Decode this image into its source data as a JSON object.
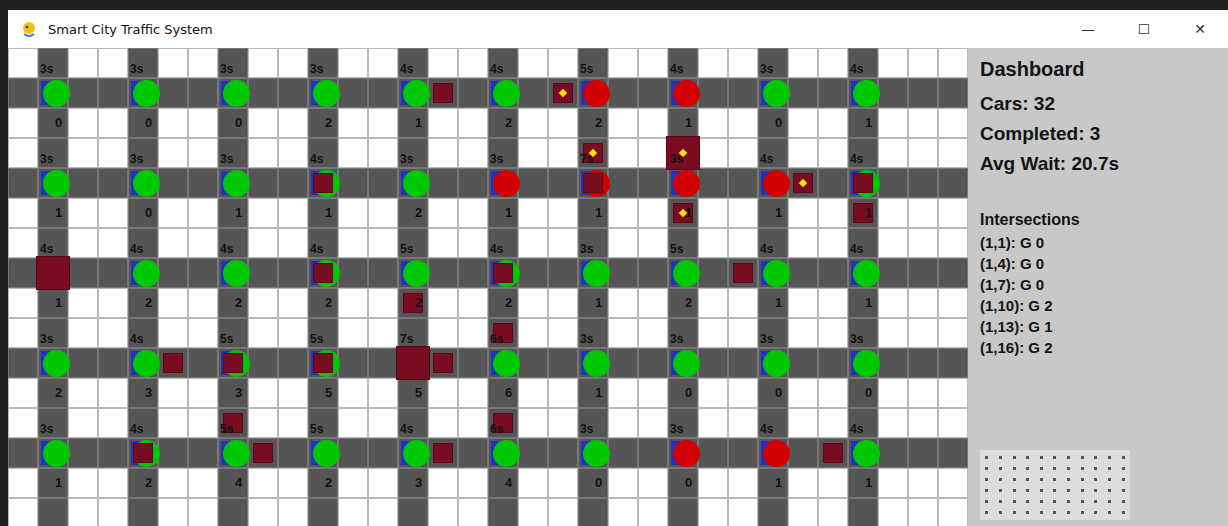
{
  "window": {
    "title": "Smart City Traffic System",
    "controls": [
      "—",
      "☐",
      "✕"
    ]
  },
  "dashboard": {
    "title": "Dashboard",
    "stats": [
      "Cars: 32",
      "Completed: 3",
      "Avg Wait: 20.7s"
    ],
    "intersections_title": "Intersections",
    "intersections": [
      "(1,1): G 0",
      "(1,4): G 0",
      "(1,7): G 0",
      "(1,10): G 2",
      "(1,13): G 1",
      "(1,16): G 2"
    ]
  },
  "grid": {
    "intersection_rows": [
      [
        {
          "timer": "3s",
          "color": "#00c800",
          "queue": "0"
        },
        {
          "timer": "3s",
          "color": "#00c800",
          "queue": "0"
        },
        {
          "timer": "3s",
          "color": "#00c800",
          "queue": "0"
        },
        {
          "timer": "3s",
          "color": "#00c800",
          "queue": "2"
        },
        {
          "timer": "4s",
          "color": "#00c800",
          "queue": "1"
        },
        {
          "timer": "4s",
          "color": "#00c800",
          "queue": "2"
        },
        {
          "timer": "5s",
          "color": "#d20000",
          "queue": "2"
        },
        {
          "timer": "4s",
          "color": "#d20000",
          "queue": "1"
        },
        {
          "timer": "3s",
          "color": "#00c800",
          "queue": "0"
        },
        {
          "timer": "4s",
          "color": "#00c800",
          "queue": "1"
        }
      ],
      [
        {
          "timer": "3s",
          "color": "#00c800",
          "queue": "1"
        },
        {
          "timer": "3s",
          "color": "#00c800",
          "queue": "0"
        },
        {
          "timer": "3s",
          "color": "#00c800",
          "queue": "1"
        },
        {
          "timer": "4s",
          "color": "#00c800",
          "queue": "1"
        },
        {
          "timer": "3s",
          "color": "#00c800",
          "queue": "2"
        },
        {
          "timer": "3s",
          "color": "#d20000",
          "queue": "1"
        },
        {
          "timer": "7s",
          "color": "#d20000",
          "queue": "1"
        },
        {
          "timer": "3s",
          "color": "#d20000",
          "queue": "1"
        },
        {
          "timer": "4s",
          "color": "#d20000",
          "queue": "1"
        },
        {
          "timer": "4s",
          "color": "#00c800",
          "queue": "1"
        }
      ],
      [
        {
          "timer": "4s",
          "color": "#00c800",
          "queue": "1"
        },
        {
          "timer": "4s",
          "color": "#00c800",
          "queue": "2"
        },
        {
          "timer": "4s",
          "color": "#00c800",
          "queue": "2"
        },
        {
          "timer": "4s",
          "color": "#00c800",
          "queue": "2"
        },
        {
          "timer": "5s",
          "color": "#00c800",
          "queue": "2"
        },
        {
          "timer": "4s",
          "color": "#00c800",
          "queue": "2"
        },
        {
          "timer": "3s",
          "color": "#00c800",
          "queue": "1"
        },
        {
          "timer": "5s",
          "color": "#00c800",
          "queue": "2"
        },
        {
          "timer": "4s",
          "color": "#00c800",
          "queue": "1"
        },
        {
          "timer": "4s",
          "color": "#00c800",
          "queue": "1"
        }
      ],
      [
        {
          "timer": "3s",
          "color": "#00c800",
          "queue": "2"
        },
        {
          "timer": "4s",
          "color": "#00c800",
          "queue": "3"
        },
        {
          "timer": "5s",
          "color": "#00c800",
          "queue": "3"
        },
        {
          "timer": "5s",
          "color": "#00c800",
          "queue": "5"
        },
        {
          "timer": "7s",
          "color": "#00c800",
          "queue": "5"
        },
        {
          "timer": "6s",
          "color": "#00c800",
          "queue": "6"
        },
        {
          "timer": "3s",
          "color": "#00c800",
          "queue": "1"
        },
        {
          "timer": "3s",
          "color": "#00c800",
          "queue": "0"
        },
        {
          "timer": "3s",
          "color": "#00c800",
          "queue": "0"
        },
        {
          "timer": "3s",
          "color": "#00c800",
          "queue": "0"
        }
      ],
      [
        {
          "timer": "3s",
          "color": "#00c800",
          "queue": "1"
        },
        {
          "timer": "4s",
          "color": "#00c800",
          "queue": "2"
        },
        {
          "timer": "5s",
          "color": "#00c800",
          "queue": "4"
        },
        {
          "timer": "5s",
          "color": "#00c800",
          "queue": "2"
        },
        {
          "timer": "4s",
          "color": "#00c800",
          "queue": "3"
        },
        {
          "timer": "6s",
          "color": "#00c800",
          "queue": "4"
        },
        {
          "timer": "3s",
          "color": "#00c800",
          "queue": "0"
        },
        {
          "timer": "3s",
          "color": "#d20000",
          "queue": "0"
        },
        {
          "timer": "4s",
          "color": "#d20000",
          "queue": "1"
        },
        {
          "timer": "4s",
          "color": "#00c800",
          "queue": "1"
        }
      ]
    ],
    "cars": [
      {
        "col": 14,
        "row": 1,
        "emergency": false,
        "large": false
      },
      {
        "col": 18,
        "row": 1,
        "emergency": true,
        "large": false
      },
      {
        "col": 19,
        "row": 3,
        "emergency": true,
        "large": false
      },
      {
        "col": 22,
        "row": 3,
        "emergency": true,
        "large": true
      },
      {
        "col": 19,
        "row": 4,
        "emergency": false,
        "large": false
      },
      {
        "col": 22,
        "row": 5,
        "emergency": true,
        "large": false
      },
      {
        "col": 26,
        "row": 4,
        "emergency": true,
        "large": false
      },
      {
        "col": 28,
        "row": 4,
        "emergency": false,
        "large": false
      },
      {
        "col": 28,
        "row": 5,
        "emergency": false,
        "large": false
      },
      {
        "col": 10,
        "row": 4,
        "emergency": false,
        "large": false
      },
      {
        "col": 1,
        "row": 7,
        "emergency": false,
        "large": true
      },
      {
        "col": 10,
        "row": 7,
        "emergency": false,
        "large": false
      },
      {
        "col": 16,
        "row": 7,
        "emergency": false,
        "large": false
      },
      {
        "col": 13,
        "row": 8,
        "emergency": false,
        "large": false
      },
      {
        "col": 24,
        "row": 7,
        "emergency": false,
        "large": false
      },
      {
        "col": 16,
        "row": 9,
        "emergency": false,
        "large": false
      },
      {
        "col": 5,
        "row": 10,
        "emergency": false,
        "large": false
      },
      {
        "col": 7,
        "row": 10,
        "emergency": false,
        "large": false
      },
      {
        "col": 10,
        "row": 10,
        "emergency": false,
        "large": false
      },
      {
        "col": 13,
        "row": 10,
        "emergency": false,
        "large": true
      },
      {
        "col": 14,
        "row": 10,
        "emergency": false,
        "large": false
      },
      {
        "col": 7,
        "row": 12,
        "emergency": false,
        "large": false
      },
      {
        "col": 16,
        "row": 12,
        "emergency": false,
        "large": false
      },
      {
        "col": 4,
        "row": 13,
        "emergency": false,
        "large": false
      },
      {
        "col": 8,
        "row": 13,
        "emergency": false,
        "large": false
      },
      {
        "col": 14,
        "row": 13,
        "emergency": false,
        "large": false
      },
      {
        "col": 27,
        "row": 13,
        "emergency": false,
        "large": false
      }
    ]
  }
}
